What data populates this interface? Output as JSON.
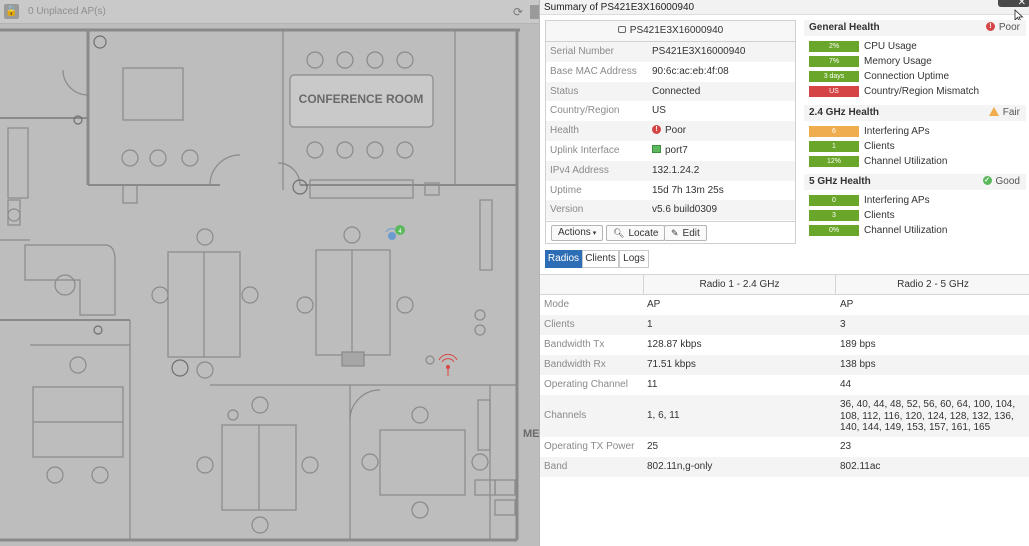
{
  "map": {
    "lock_icon": "lock-icon",
    "unplaced_label": "0 Unplaced AP(s)",
    "refresh_icon": "refresh-icon",
    "conference_room_label": "CONFERENCE ROOM",
    "partial_room_label": "ME",
    "ap_marker_count": "4"
  },
  "panel": {
    "title": "Summary of PS421E3X16000940",
    "close_label": "✕"
  },
  "device": {
    "name": "PS421E3X16000940",
    "rows": [
      {
        "key": "Serial Number",
        "value": "PS421E3X16000940"
      },
      {
        "key": "Base MAC Address",
        "value": "90:6c:ac:eb:4f:08"
      },
      {
        "key": "Status",
        "value": "Connected"
      },
      {
        "key": "Country/Region",
        "value": "US"
      },
      {
        "key": "Health",
        "value": "Poor"
      },
      {
        "key": "Uplink Interface",
        "value": "port7"
      },
      {
        "key": "IPv4 Address",
        "value": "132.1.24.2"
      },
      {
        "key": "Uptime",
        "value": "15d 7h 13m 25s"
      },
      {
        "key": "Version",
        "value": "v5.6 build0309"
      }
    ],
    "actions": {
      "actions_label": "Actions",
      "locate_label": "Locate",
      "edit_label": "Edit"
    }
  },
  "health": {
    "general": {
      "title": "General Health",
      "status": "Poor",
      "rows": [
        {
          "badge": "2%",
          "label": "CPU Usage",
          "color": "#6aa629"
        },
        {
          "badge": "7%",
          "label": "Memory Usage",
          "color": "#6aa629"
        },
        {
          "badge": "3 days",
          "label": "Connection Uptime",
          "color": "#6aa629"
        },
        {
          "badge": "US",
          "label": "Country/Region Mismatch",
          "color": "#d64545"
        }
      ]
    },
    "ghz24": {
      "title": "2.4 GHz Health",
      "status": "Fair",
      "rows": [
        {
          "badge": "6",
          "label": "Interfering APs",
          "color": "#f0ad4e"
        },
        {
          "badge": "1",
          "label": "Clients",
          "color": "#6aa629"
        },
        {
          "badge": "12%",
          "label": "Channel Utilization",
          "color": "#6aa629"
        }
      ]
    },
    "ghz5": {
      "title": "5 GHz Health",
      "status": "Good",
      "rows": [
        {
          "badge": "0",
          "label": "Interfering APs",
          "color": "#6aa629"
        },
        {
          "badge": "3",
          "label": "Clients",
          "color": "#6aa629"
        },
        {
          "badge": "0%",
          "label": "Channel Utilization",
          "color": "#6aa629"
        }
      ]
    }
  },
  "tabs": [
    "Radios",
    "Clients",
    "Logs"
  ],
  "radio_table": {
    "headers": [
      "",
      "Radio 1 - 2.4 GHz",
      "Radio 2 - 5 GHz"
    ],
    "rows": [
      {
        "key": "Mode",
        "r1": "AP",
        "r2": "AP"
      },
      {
        "key": "Clients",
        "r1": "1",
        "r2": "3"
      },
      {
        "key": "Bandwidth Tx",
        "r1": "128.87 kbps",
        "r2": "189 bps"
      },
      {
        "key": "Bandwidth Rx",
        "r1": "71.51 kbps",
        "r2": "138 bps"
      },
      {
        "key": "Operating Channel",
        "r1": "11",
        "r2": "44"
      },
      {
        "key": "Channels",
        "r1": "1, 6, 11",
        "r2": "36, 40, 44, 48, 52, 56, 60, 64, 100, 104, 108, 112, 116, 120, 124, 128, 132, 136, 140, 144, 149, 153, 157, 161, 165"
      },
      {
        "key": "Operating TX Power",
        "r1": "25",
        "r2": "23"
      },
      {
        "key": "Band",
        "r1": "802.11n,g-only",
        "r2": "802.11ac"
      }
    ]
  }
}
